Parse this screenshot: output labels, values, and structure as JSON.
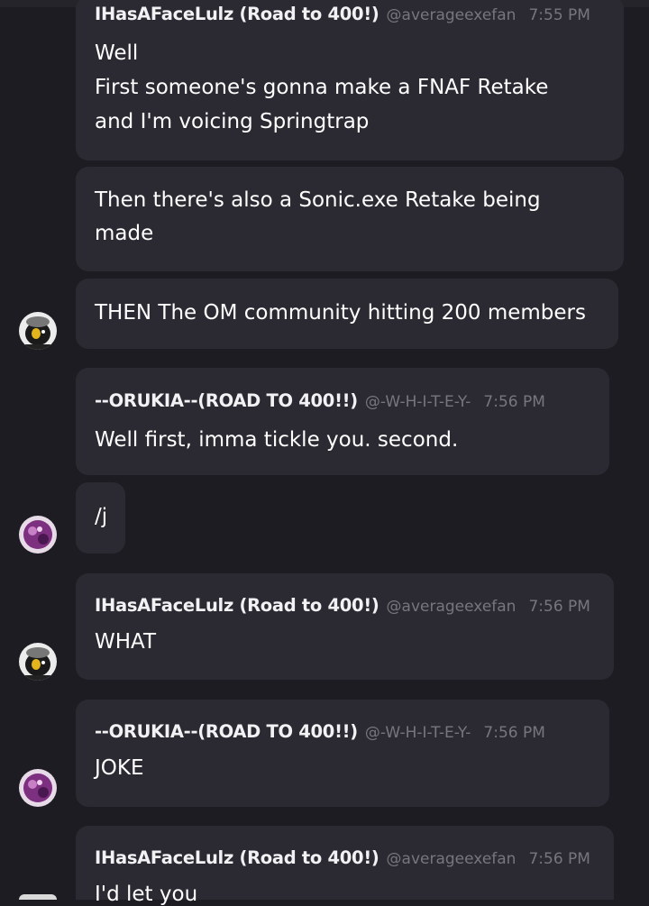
{
  "messages": [
    {
      "author": "IHasAFaceLulz (Road to 400!)",
      "handle": "@averageexefan",
      "time": "7:55 PM",
      "lines": [
        "Well",
        "First someone's gonna make a FNAF Retake",
        "and I'm voicing Springtrap"
      ]
    },
    {
      "lines": [
        "Then there's also a Sonic.exe Retake being",
        "made"
      ]
    },
    {
      "lines": [
        "THEN The OM community hitting 200 members"
      ]
    },
    {
      "author": "--ORUKIA--(ROAD TO 400!!)",
      "handle": "@-W-H-I-T-E-Y-",
      "time": "7:56 PM",
      "lines": [
        "Well first, imma tickle you. second."
      ]
    },
    {
      "lines": [
        "/j"
      ]
    },
    {
      "author": "IHasAFaceLulz (Road to 400!)",
      "handle": "@averageexefan",
      "time": "7:56 PM",
      "lines": [
        "WHAT"
      ]
    },
    {
      "author": "--ORUKIA--(ROAD TO 400!!)",
      "handle": "@-W-H-I-T-E-Y-",
      "time": "7:56 PM",
      "lines": [
        "JOKE"
      ]
    },
    {
      "author": "IHasAFaceLulz (Road to 400!)",
      "handle": "@averageexefan",
      "time": "7:56 PM",
      "lines": [
        "I'd let you"
      ]
    }
  ],
  "avatars": {
    "ihasaface": {
      "icon": "penguin-avatar-icon",
      "color": "#d9d9d9"
    },
    "orukia": {
      "icon": "purple-anime-avatar-icon",
      "color": "#8a3d8c"
    }
  }
}
